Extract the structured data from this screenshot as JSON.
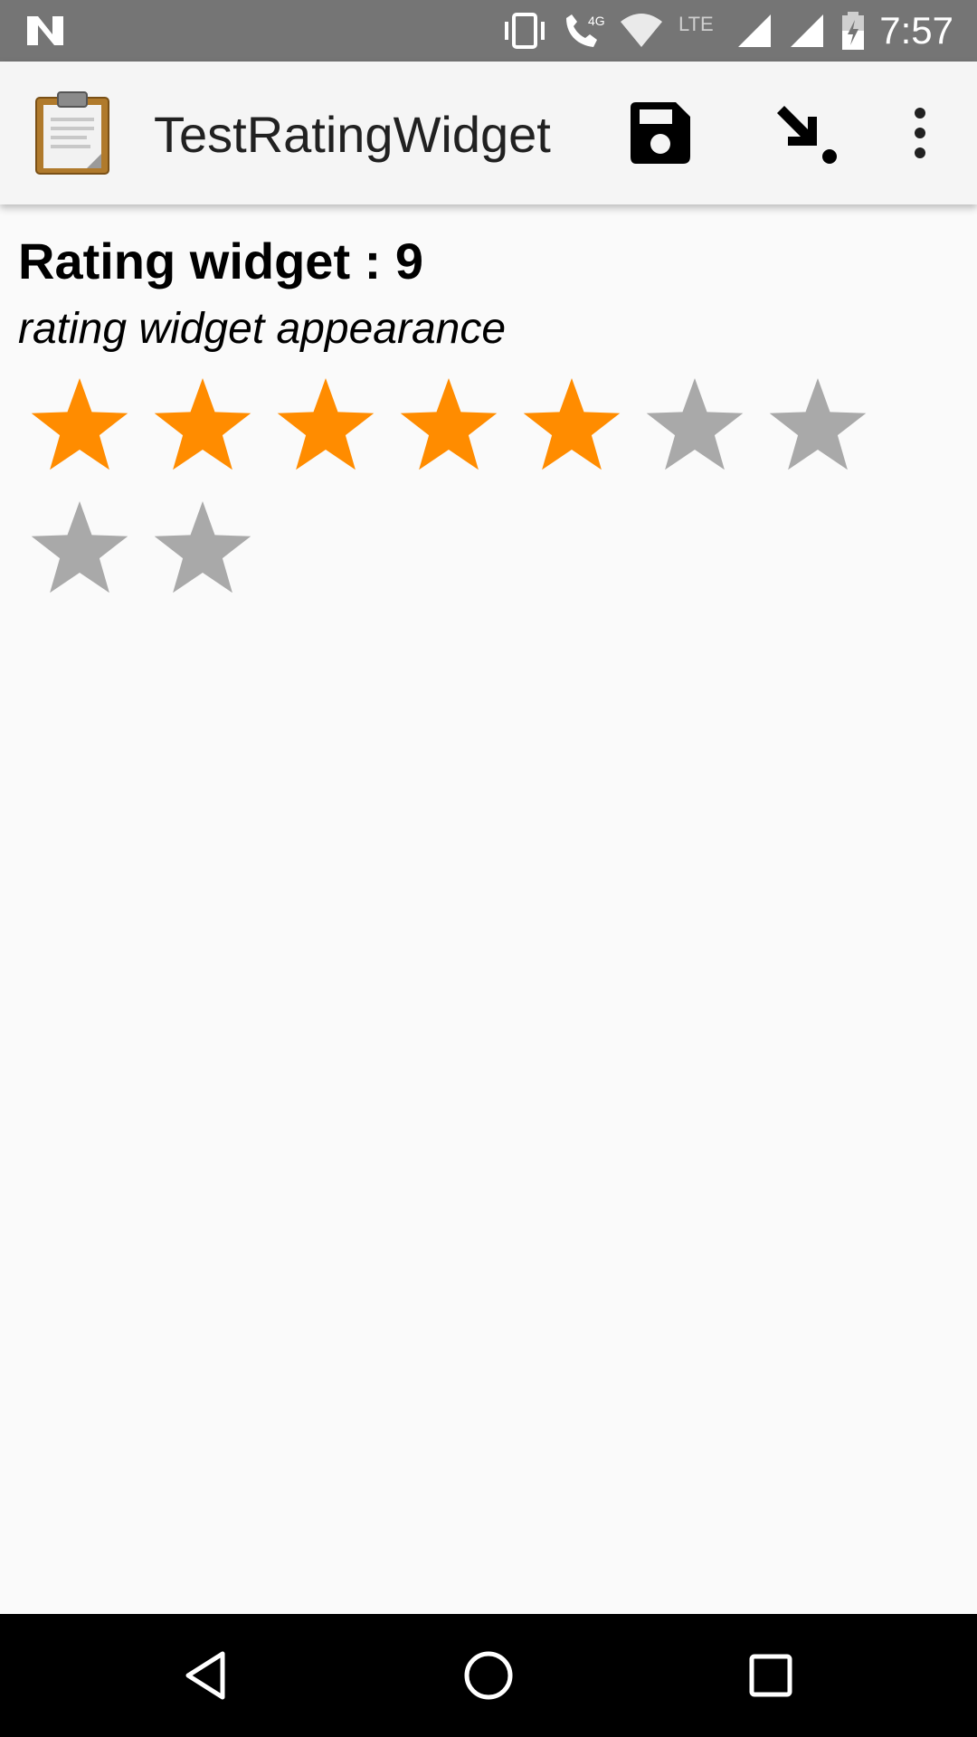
{
  "status_bar": {
    "time": "7:57",
    "network_label": "4G",
    "lte_label": "LTE",
    "icons": [
      "n-logo-icon",
      "vibrate-icon",
      "wifi-calling-icon",
      "wifi-icon",
      "signal-icon",
      "signal-icon",
      "battery-charging-icon"
    ]
  },
  "app_bar": {
    "title": "TestRatingWidget",
    "icons": [
      "form-clipboard-icon",
      "save-icon",
      "go-to-icon",
      "more-vert-icon"
    ]
  },
  "question": {
    "label": "Rating widget : 9",
    "hint": "rating widget appearance",
    "rating": {
      "max": 9,
      "selected": 5
    }
  },
  "colors": {
    "star_filled": "#ff8c00",
    "star_empty": "#a9a9a9",
    "status_bar_bg": "#757575",
    "app_bar_bg": "#f5f5f5",
    "nav_bar_bg": "#000000"
  },
  "nav_bar": {
    "icons": [
      "back-icon",
      "home-icon",
      "recents-icon"
    ]
  }
}
